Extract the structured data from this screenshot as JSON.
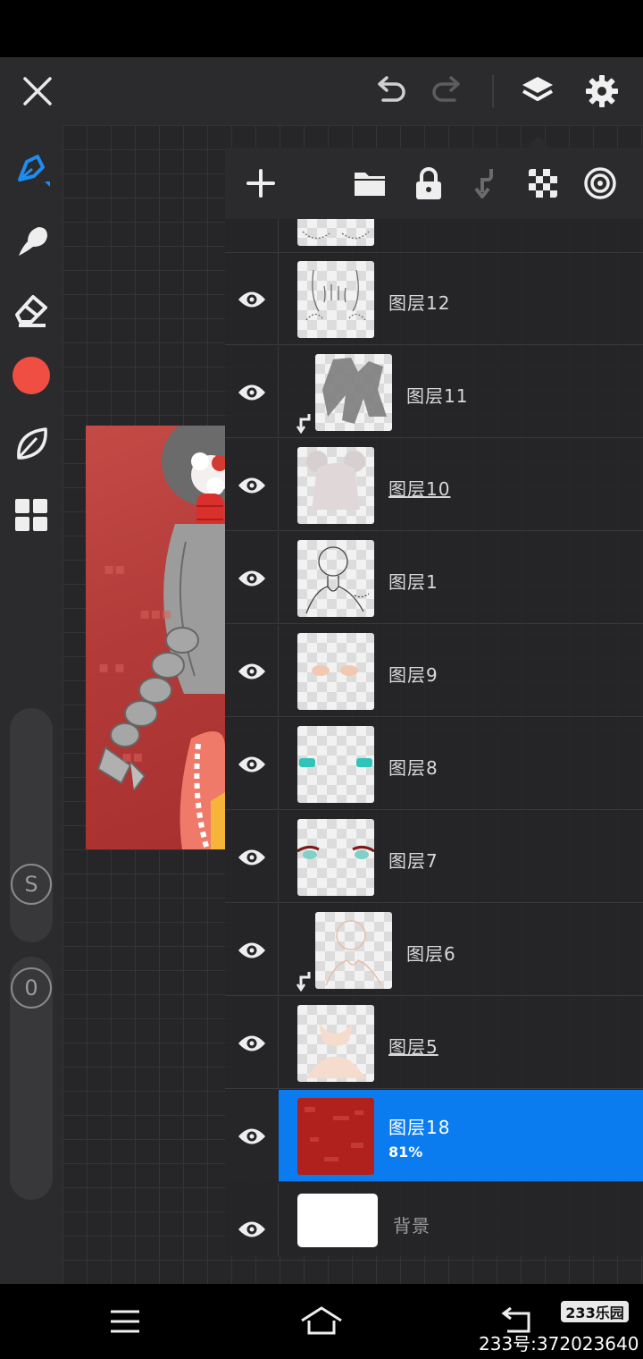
{
  "app": {
    "toolbar": {
      "icons": [
        "close-icon",
        "undo-icon",
        "redo-icon",
        "layers-icon",
        "settings-icon"
      ]
    },
    "tools": {
      "items": [
        "brush-icon",
        "smudge-icon",
        "eraser-icon",
        "color-swatch",
        "leaf-icon",
        "grid-icon"
      ],
      "active_color": "#f04e43",
      "accent": "#1e8cf0",
      "size_indicator": "S",
      "opacity_indicator": "0"
    }
  },
  "layer_panel": {
    "actions": [
      "add-icon",
      "folder-icon",
      "lock-icon",
      "merge-down-icon",
      "transparency-icon",
      "alpha-icon"
    ],
    "layers": [
      {
        "name": "图层12",
        "underlined": false,
        "clipped": false,
        "selected": false
      },
      {
        "name": "图层11",
        "underlined": false,
        "clipped": true,
        "selected": false
      },
      {
        "name": "图层10",
        "underlined": true,
        "clipped": false,
        "selected": false
      },
      {
        "name": "图层1",
        "underlined": false,
        "clipped": false,
        "selected": false
      },
      {
        "name": "图层9",
        "underlined": false,
        "clipped": false,
        "selected": false
      },
      {
        "name": "图层8",
        "underlined": false,
        "clipped": false,
        "selected": false
      },
      {
        "name": "图层7",
        "underlined": false,
        "clipped": false,
        "selected": false
      },
      {
        "name": "图层6",
        "underlined": false,
        "clipped": true,
        "selected": false
      },
      {
        "name": "图层5",
        "underlined": true,
        "clipped": false,
        "selected": false
      },
      {
        "name": "图层18",
        "underlined": false,
        "clipped": false,
        "selected": true,
        "opacity": "81%"
      },
      {
        "name": "背景",
        "underlined": false,
        "clipped": false,
        "selected": false
      }
    ],
    "selected_color": "#0a7cf0"
  },
  "nav": {
    "icons": [
      "menu-icon",
      "home-icon",
      "back-icon"
    ]
  },
  "watermark": {
    "badge": "233乐园",
    "id_text": "233号:372023640"
  }
}
